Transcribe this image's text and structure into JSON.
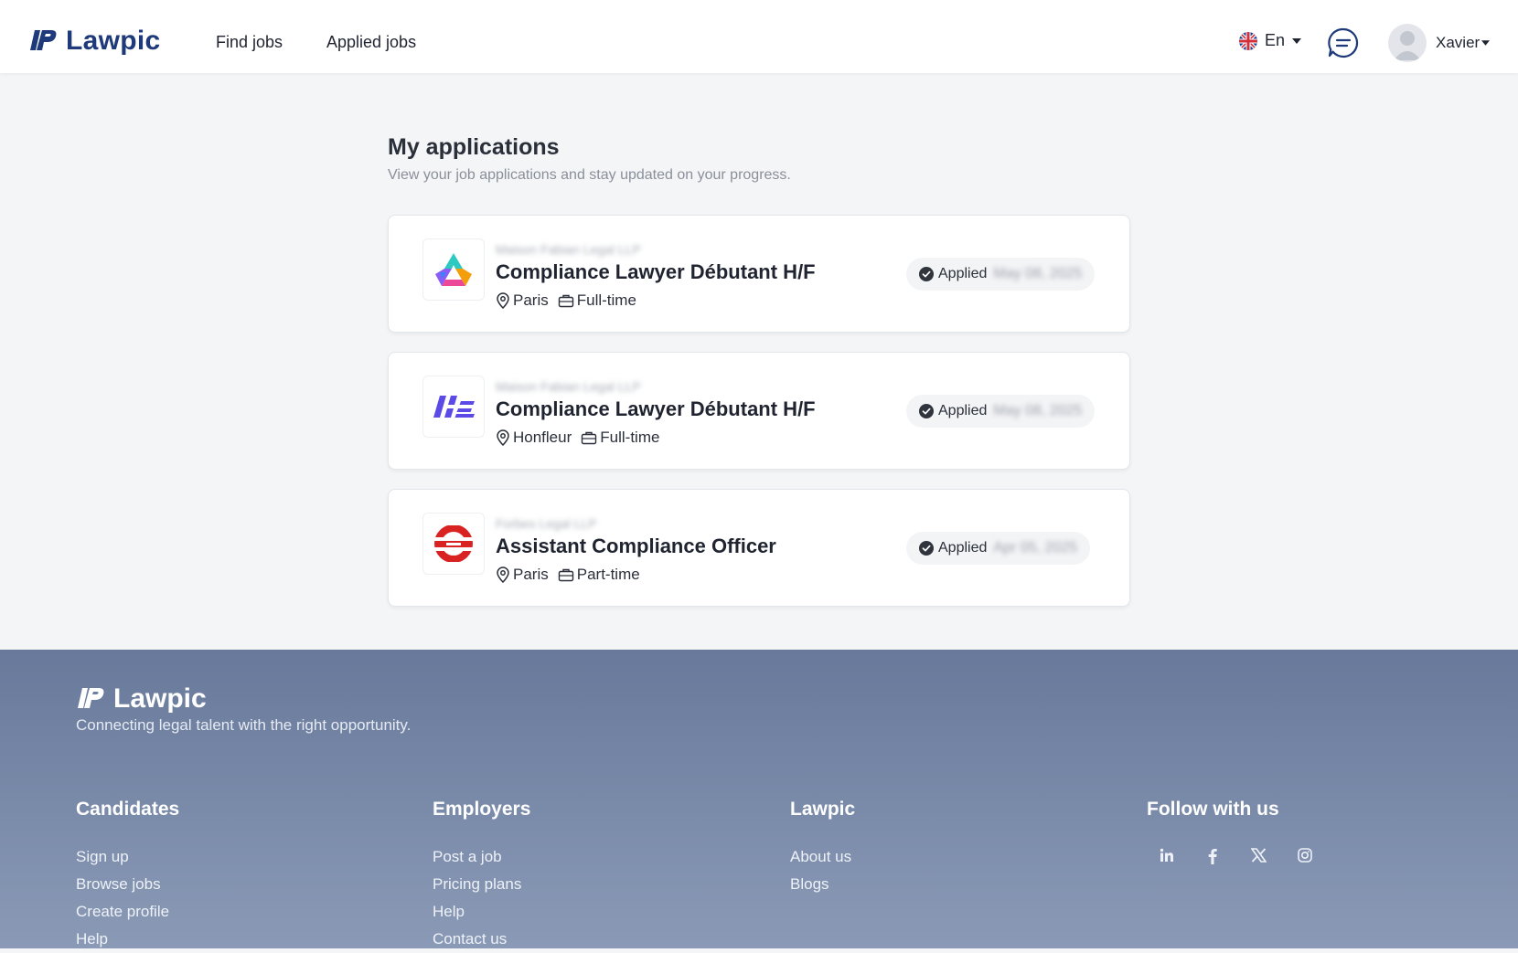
{
  "header": {
    "logo_text": "Lawpic",
    "nav": [
      {
        "label": "Find jobs"
      },
      {
        "label": "Applied jobs"
      }
    ],
    "language": "En",
    "user_name": "Xavier"
  },
  "main": {
    "title": "My applications",
    "subtitle": "View your job applications and stay updated on your progress.",
    "applications": [
      {
        "company": "Maison Fabian Legal LLP",
        "title": "Compliance Lawyer Débutant H/F",
        "location": "Paris",
        "job_type": "Full-time",
        "status": "Applied",
        "date": "May 08, 2025",
        "logo_icon": "multicolor-triangle-logo"
      },
      {
        "company": "Maison Fabian Legal LLP",
        "title": "Compliance Lawyer Débutant H/F",
        "location": "Honfleur",
        "job_type": "Full-time",
        "status": "Applied",
        "date": "May 08, 2025",
        "logo_icon": "purple-stripes-logo"
      },
      {
        "company": "Forbes Legal LLP",
        "title": "Assistant Compliance Officer",
        "location": "Paris",
        "job_type": "Part-time",
        "status": "Applied",
        "date": "Apr 05, 2025",
        "logo_icon": "red-circle-logo"
      }
    ]
  },
  "footer": {
    "logo_text": "Lawpic",
    "tagline": "Connecting legal talent with the right opportunity.",
    "columns": [
      {
        "heading": "Candidates",
        "links": [
          "Sign up",
          "Browse jobs",
          "Create profile",
          "Help"
        ]
      },
      {
        "heading": "Employers",
        "links": [
          "Post a job",
          "Pricing plans",
          "Help",
          "Contact us"
        ]
      },
      {
        "heading": "Lawpic",
        "links": [
          "About us",
          "Blogs"
        ]
      },
      {
        "heading": "Follow with us",
        "social": [
          "linkedin-icon",
          "facebook-icon",
          "x-icon",
          "instagram-icon"
        ]
      }
    ]
  },
  "colors": {
    "brand": "#1e3a7a",
    "footer_top": "#68799b",
    "footer_bottom": "#8a9ab6",
    "page_bg": "#f4f5f7"
  }
}
